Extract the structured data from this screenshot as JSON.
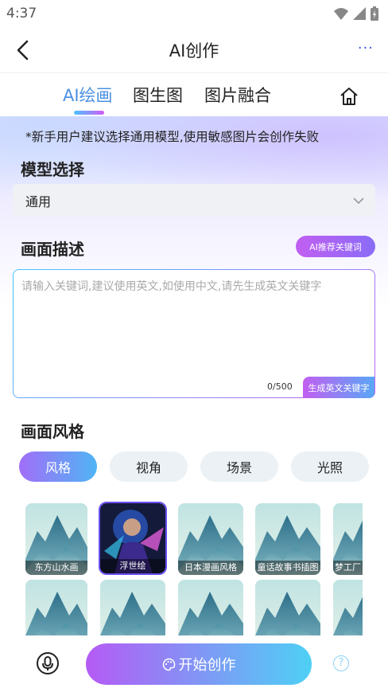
{
  "status_bar": {
    "time": "4:37"
  },
  "header": {
    "title": "AI创作",
    "more": "···"
  },
  "tabs": [
    {
      "label": "AI绘画",
      "active": true
    },
    {
      "label": "图生图",
      "active": false
    },
    {
      "label": "图片融合",
      "active": false
    }
  ],
  "notice": "*新手用户建议选择通用模型,使用敏感图片会创作失败",
  "model": {
    "title": "模型选择",
    "selected": "通用"
  },
  "description": {
    "title": "画面描述",
    "ai_keyword_button": "AI推荐关键词",
    "placeholder": "请输入关键词,建议使用英文,如使用中文,请先生成英文关键字",
    "value": "",
    "count": "0/500",
    "generate_button": "生成英文关键字"
  },
  "style": {
    "title": "画面风格",
    "tabs": [
      {
        "label": "风格",
        "active": true
      },
      {
        "label": "视角",
        "active": false
      },
      {
        "label": "场景",
        "active": false
      },
      {
        "label": "光照",
        "active": false
      }
    ],
    "thumbnails_row1": [
      "东方山水画",
      "浮世绘",
      "日本漫画风格",
      "童话故事书插图",
      "梦工厂"
    ],
    "selected": "浮世绘"
  },
  "bottom": {
    "start_button": "开始创作",
    "help": "?"
  },
  "colors": {
    "accent_blue": "#4a90e2",
    "accent_purple": "#b55bf5",
    "accent_cyan": "#4ed0f5"
  }
}
